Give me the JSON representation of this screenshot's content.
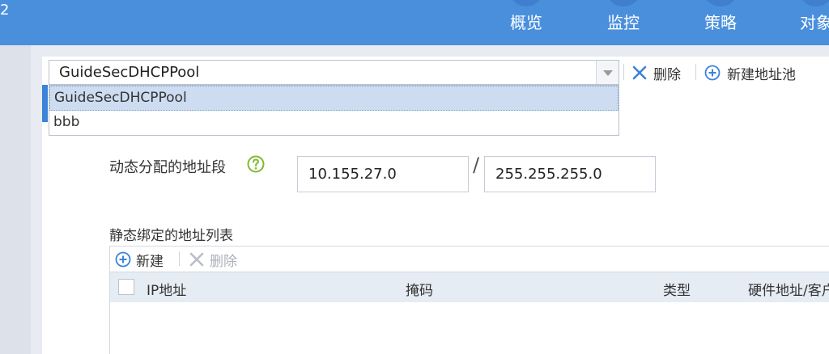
{
  "header": {
    "brand_fragment": "2",
    "nav": [
      {
        "label": "概览"
      },
      {
        "label": "监控"
      },
      {
        "label": "策略"
      },
      {
        "label": "对象"
      }
    ]
  },
  "pool": {
    "selected": "GuideSecDHCPPool",
    "options": [
      "GuideSecDHCPPool",
      "bbb"
    ],
    "delete_label": "删除",
    "new_label": "新建地址池"
  },
  "range": {
    "label": "动态分配的地址段",
    "ip": "10.155.27.0",
    "separator": "/",
    "mask": "255.255.255.0"
  },
  "static_list": {
    "label": "静态绑定的地址列表",
    "new_label": "新建",
    "delete_label": "删除",
    "columns": [
      "IP地址",
      "掩码",
      "类型",
      "硬件地址/客户"
    ]
  },
  "colors": {
    "topbar": "#4a8fdc",
    "accent": "#3b83d8",
    "selected_option": "#cddcf1",
    "help_green": "#7dbb2f"
  }
}
